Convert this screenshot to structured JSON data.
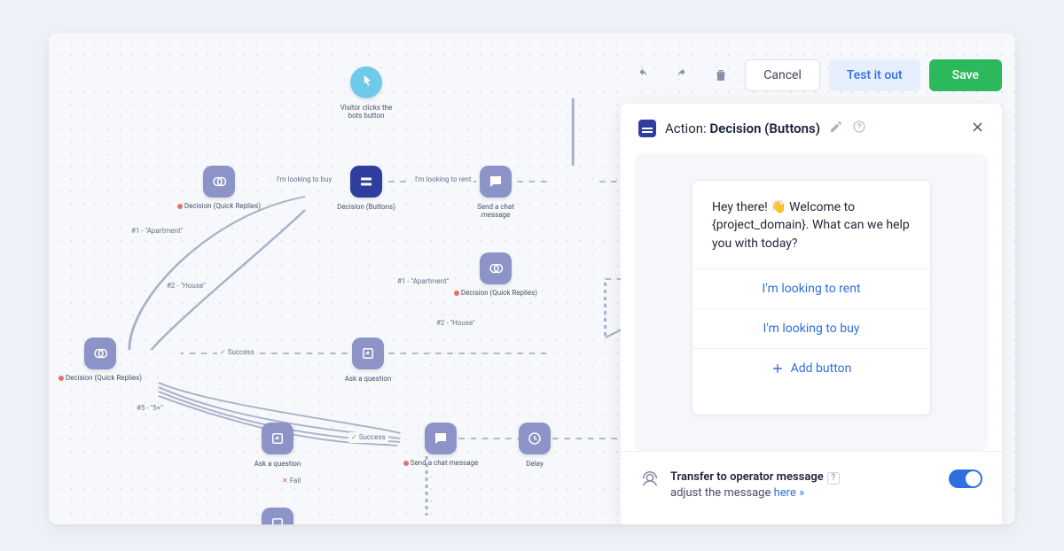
{
  "toolbar": {
    "cancel": "Cancel",
    "test": "Test it out",
    "save": "Save"
  },
  "panel": {
    "action_prefix": "Action:",
    "action_name": "Decision (Buttons)",
    "message": "Hey there! 👋 Welcome to {project_domain}. What can we help you with today?",
    "buttons": [
      "I'm looking to rent",
      "I'm looking to buy"
    ],
    "add_button": "Add button",
    "transfer": {
      "title": "Transfer to operator message",
      "sub_prefix": "adjust the message ",
      "sub_link": "here »",
      "enabled": true
    }
  },
  "flow": {
    "start": {
      "label": "Visitor clicks the\nbots button"
    },
    "decision": {
      "label": "Decision (Buttons)"
    },
    "dec_qr1": {
      "label": "Decision (Quick\nReplies)"
    },
    "chat1": {
      "label": "Send a chat\nmessage"
    },
    "dec_qr2": {
      "label": "Decision (Quick\nReplies)"
    },
    "dec_qr3": {
      "label": "Decision (Quick\nReplies)"
    },
    "askq1": {
      "label": "Ask a question"
    },
    "askq2": {
      "label": "Ask a question"
    },
    "chat2": {
      "label": "Send a chat\nmessage"
    },
    "delay": {
      "label": "Delay"
    }
  },
  "edges": {
    "buy": "I'm looking to buy",
    "rent": "I'm looking to rent",
    "apt1": "#1 - \"Apartment\"",
    "house2": "#2 - \"House\"",
    "apt1b": "#1 - \"Apartment\"",
    "house2b": "#2 - \"House\"",
    "n5": "#5 - \"5+\"",
    "success": "Success",
    "success2": "Success",
    "fail": "Fail"
  }
}
